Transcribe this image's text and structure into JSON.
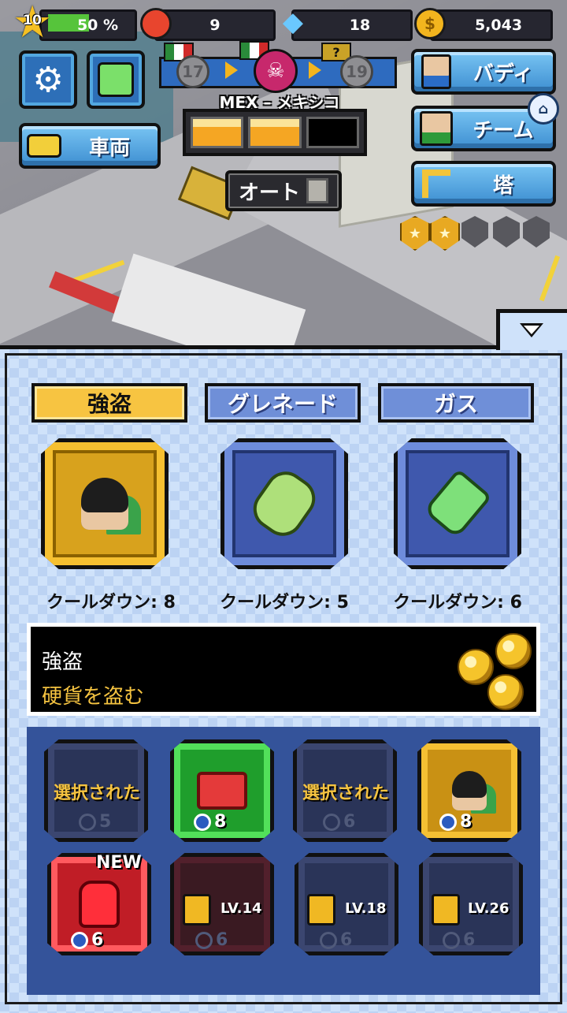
{
  "hud": {
    "player_level": "10",
    "xp_progress_text": "50 %",
    "xp_progress": 0.5,
    "tokens": "9",
    "gems": "18",
    "coins": "5,043"
  },
  "progress": {
    "previous_level": "17",
    "next_level": "19",
    "next_country_unknown": "?",
    "country_label": "MEX – メキシコ",
    "stage_segments_filled": 2,
    "stage_segments_total": 3
  },
  "buttons": {
    "vehicle": "車両",
    "buddy": "バディ",
    "team": "チーム",
    "tower": "塔",
    "auto": "オート"
  },
  "tower_badges": {
    "earned": 2,
    "total": 5
  },
  "tabs": [
    {
      "label": "強盗",
      "active": true
    },
    {
      "label": "グレネード",
      "active": false
    },
    {
      "label": "ガス",
      "active": false
    }
  ],
  "skills": [
    {
      "icon": "thief-icon",
      "cooldown": "クールダウン: 8"
    },
    {
      "icon": "grenade-icon",
      "cooldown": "クールダウン: 5"
    },
    {
      "icon": "gas-bottle-icon",
      "cooldown": "クールダウン: 6"
    }
  ],
  "description": {
    "title": "強盗",
    "subtitle": "硬貨を盗む"
  },
  "inventory": [
    {
      "state": "selected",
      "label": "選択された",
      "timer": "5"
    },
    {
      "icon": "toolbox-icon",
      "timer": "8"
    },
    {
      "state": "selected",
      "label": "選択された",
      "timer": "6"
    },
    {
      "icon": "thief-icon",
      "timer": "8"
    },
    {
      "icon": "boxing-glove-icon",
      "timer": "6",
      "tag": "NEW"
    },
    {
      "locked": true,
      "level": "LV.14",
      "timer": "6"
    },
    {
      "locked": true,
      "level": "LV.18",
      "timer": "6"
    },
    {
      "locked": true,
      "level": "LV.26",
      "timer": "6"
    }
  ],
  "colors": {
    "gold": "#f7c441",
    "blue_tab": "#6f8fd8",
    "panel_bg": "#cfe2fa",
    "accent_text": "#f5c340"
  }
}
